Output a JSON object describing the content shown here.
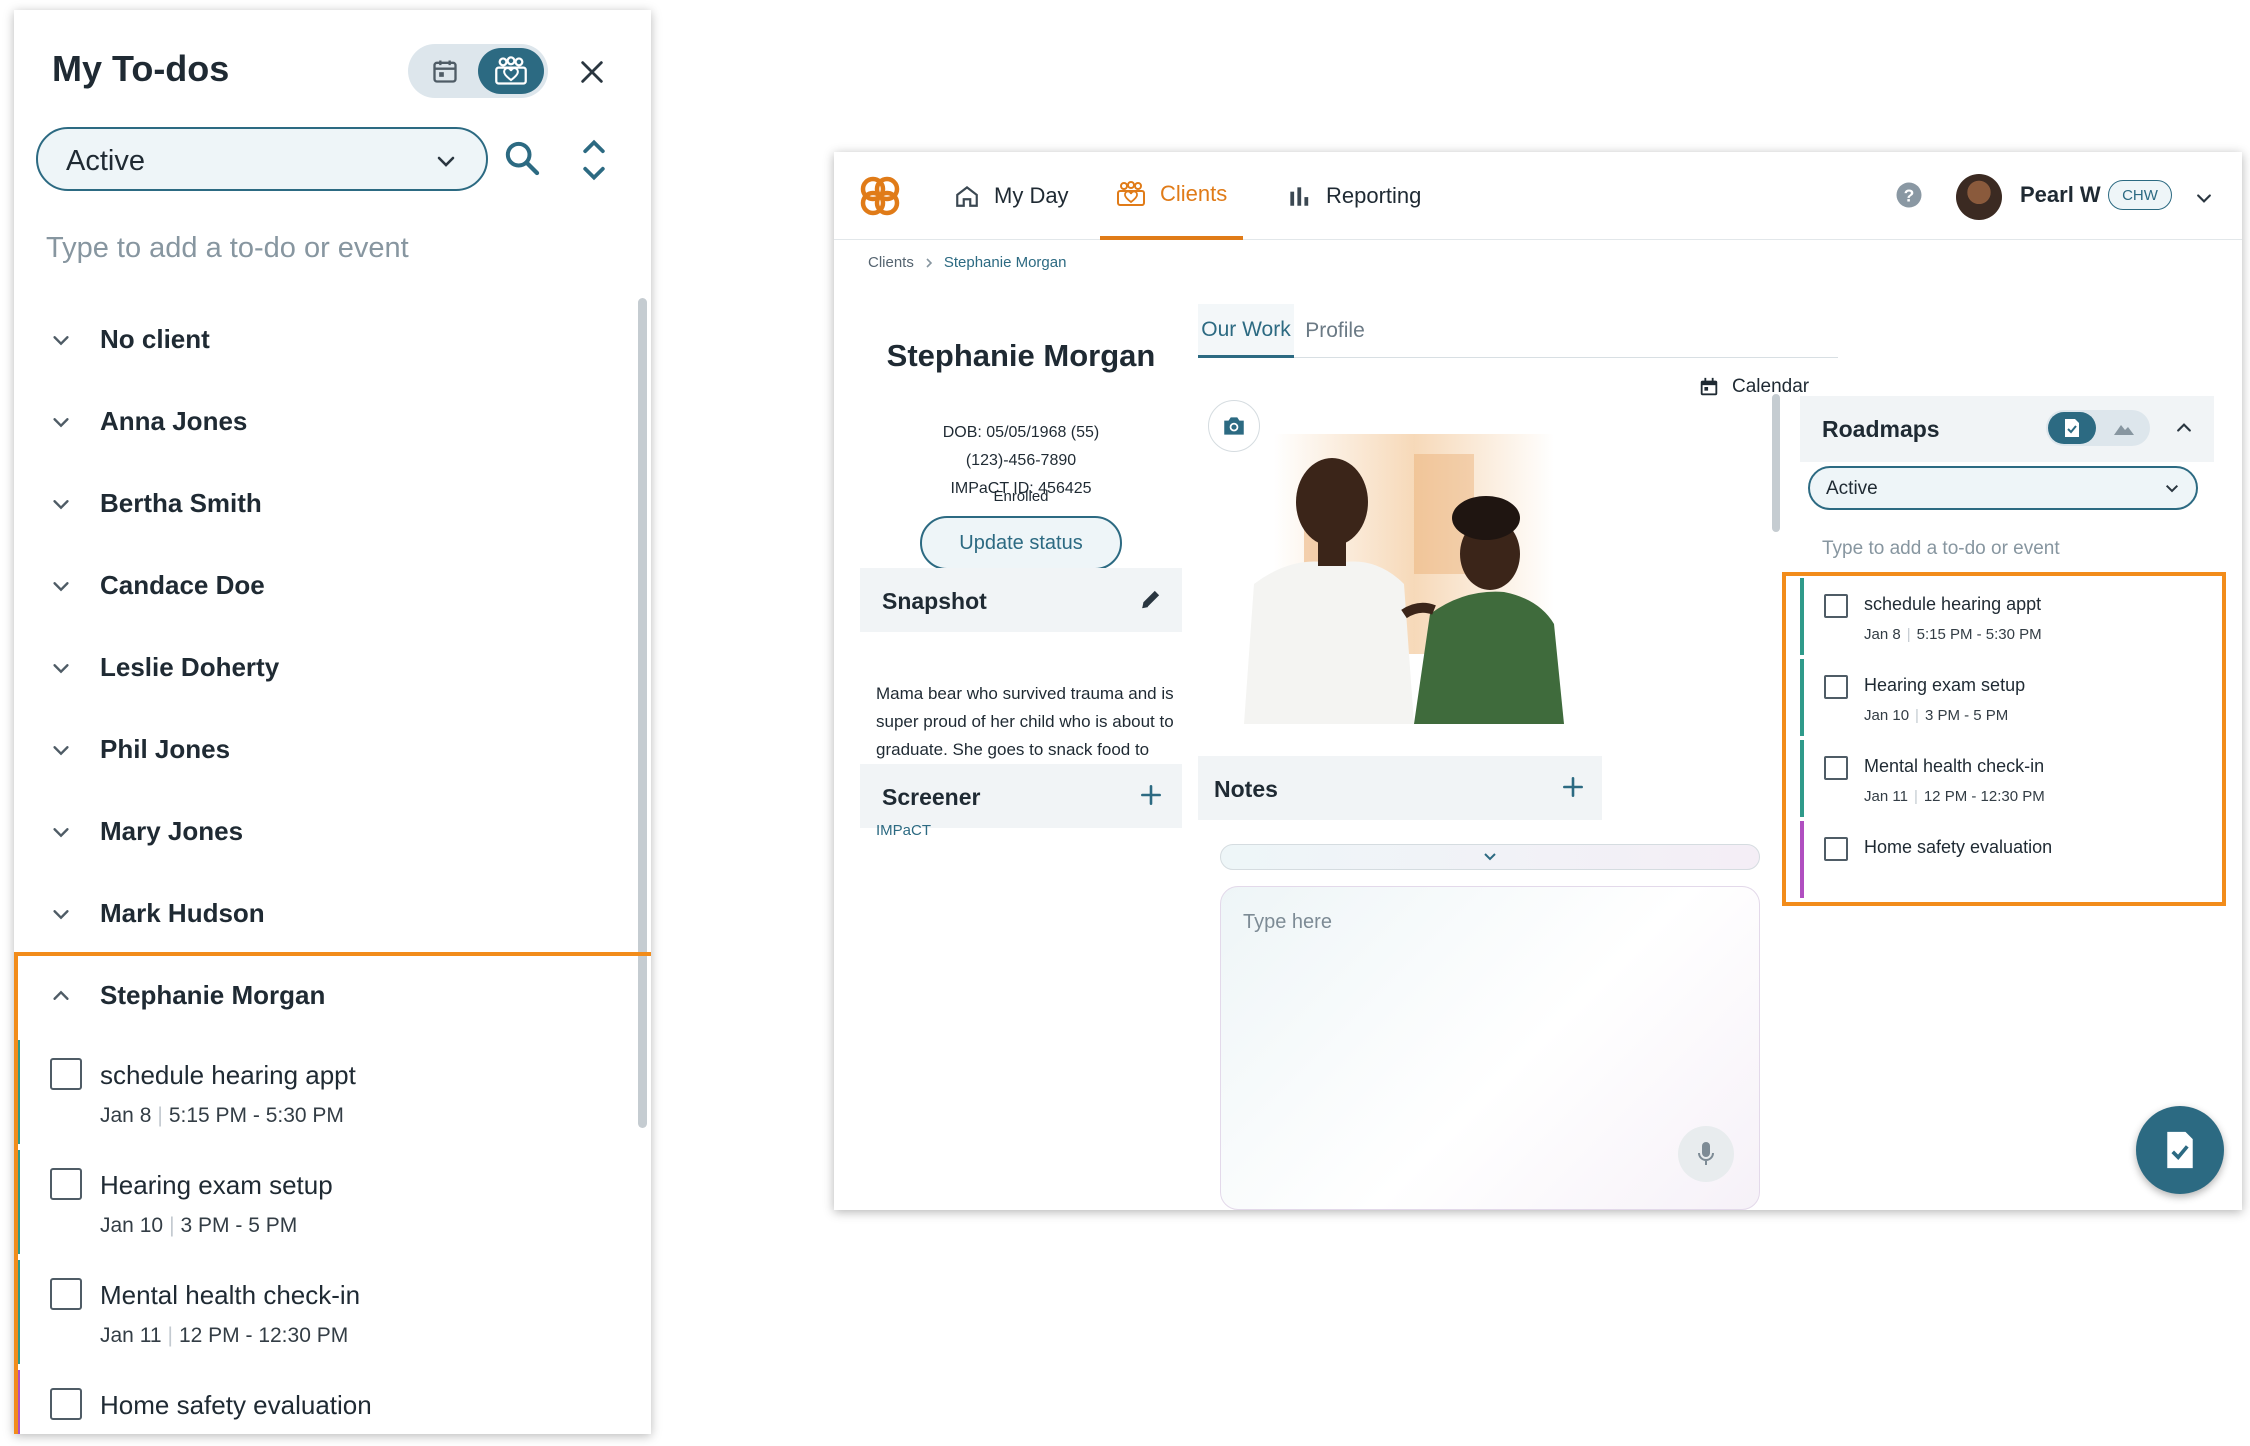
{
  "todo_panel": {
    "title": "My To-dos",
    "filter_value": "Active",
    "add_placeholder": "Type to add a to-do or event",
    "groups": [
      "No client",
      "Anna Jones",
      "Bertha Smith",
      "Candace Doe",
      "Leslie Doherty",
      "Phil Jones",
      "Mary Jones",
      "Mark Hudson"
    ],
    "expanded_group": {
      "name": "Stephanie Morgan",
      "items": [
        {
          "title": "schedule hearing appt",
          "date": "Jan 8",
          "time": "5:15 PM - 5:30 PM",
          "color": "#2f9a8a"
        },
        {
          "title": "Hearing exam setup",
          "date": "Jan 10",
          "time": "3 PM - 5 PM",
          "color": "#2f9a8a"
        },
        {
          "title": "Mental health check-in",
          "date": "Jan 11",
          "time": "12 PM - 12:30 PM",
          "color": "#2f9a8a"
        },
        {
          "title": "Home safety evaluation",
          "date": "",
          "time": "",
          "color": "#b04fc0"
        }
      ]
    }
  },
  "app": {
    "nav": {
      "items": [
        "My Day",
        "Clients",
        "Reporting"
      ],
      "active": "Clients",
      "user_name": "Pearl W",
      "user_role": "CHW"
    },
    "breadcrumb": {
      "parent": "Clients",
      "current": "Stephanie Morgan"
    },
    "client": {
      "name": "Stephanie Morgan",
      "dob": "DOB: 05/05/1968 (55)",
      "phone": "(123)-456-7890",
      "impact_id": "IMPaCT ID: 456425",
      "status": "Enrolled",
      "update_status_label": "Update status"
    },
    "snapshot": {
      "title": "Snapshot",
      "text": "Mama bear who survived trauma and is super proud of her child who is about to graduate. She goes to snack food to cope with some old bad feelings but is open to joining the YMCA."
    },
    "screener": {
      "title": "Screener",
      "link": "IMPaCT"
    },
    "tabs": [
      "Our Work",
      "Profile"
    ],
    "calendar_label": "Calendar",
    "notes": {
      "title": "Notes",
      "placeholder": "Type here"
    },
    "roadmaps": {
      "title": "Roadmaps",
      "filter_value": "Active",
      "add_placeholder": "Type to add a to-do or event",
      "items": [
        {
          "title": "schedule hearing appt",
          "date": "Jan 8",
          "time": "5:15 PM - 5:30 PM",
          "color": "#2f9a8a"
        },
        {
          "title": "Hearing exam setup",
          "date": "Jan 10",
          "time": "3 PM - 5 PM",
          "color": "#2f9a8a"
        },
        {
          "title": "Mental health check-in",
          "date": "Jan 11",
          "time": "12 PM - 12:30 PM",
          "color": "#2f9a8a"
        },
        {
          "title": "Home safety evaluation",
          "date": "",
          "time": "",
          "color": "#b04fc0"
        }
      ]
    }
  },
  "colors": {
    "primary": "#2c6a82",
    "accent": "#e07b18",
    "highlight": "#f28c1a"
  }
}
